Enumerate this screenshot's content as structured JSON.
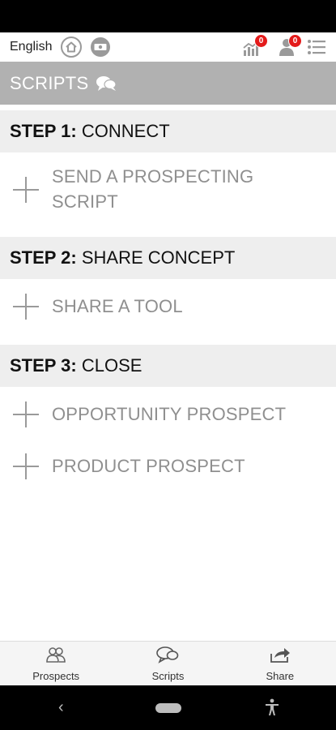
{
  "header": {
    "language": "English",
    "stats_badge": "0",
    "notifications_badge": "0"
  },
  "title_bar": {
    "title": "SCRIPTS"
  },
  "steps": [
    {
      "num": "STEP 1:",
      "name": "CONNECT",
      "items": [
        "SEND A PROSPECTING SCRIPT"
      ]
    },
    {
      "num": "STEP 2:",
      "name": "SHARE CONCEPT",
      "items": [
        "SHARE A TOOL"
      ]
    },
    {
      "num": "STEP 3:",
      "name": "CLOSE",
      "items": [
        "OPPORTUNITY PROSPECT",
        "PRODUCT PROSPECT"
      ]
    }
  ],
  "bottom_nav": {
    "prospects": "Prospects",
    "scripts": "Scripts",
    "share": "Share"
  },
  "colors": {
    "title_bar_bg": "#b1b1b1",
    "step_header_bg": "#eeeeee",
    "item_text": "#8f8f8f",
    "badge": "#e41b1b"
  }
}
